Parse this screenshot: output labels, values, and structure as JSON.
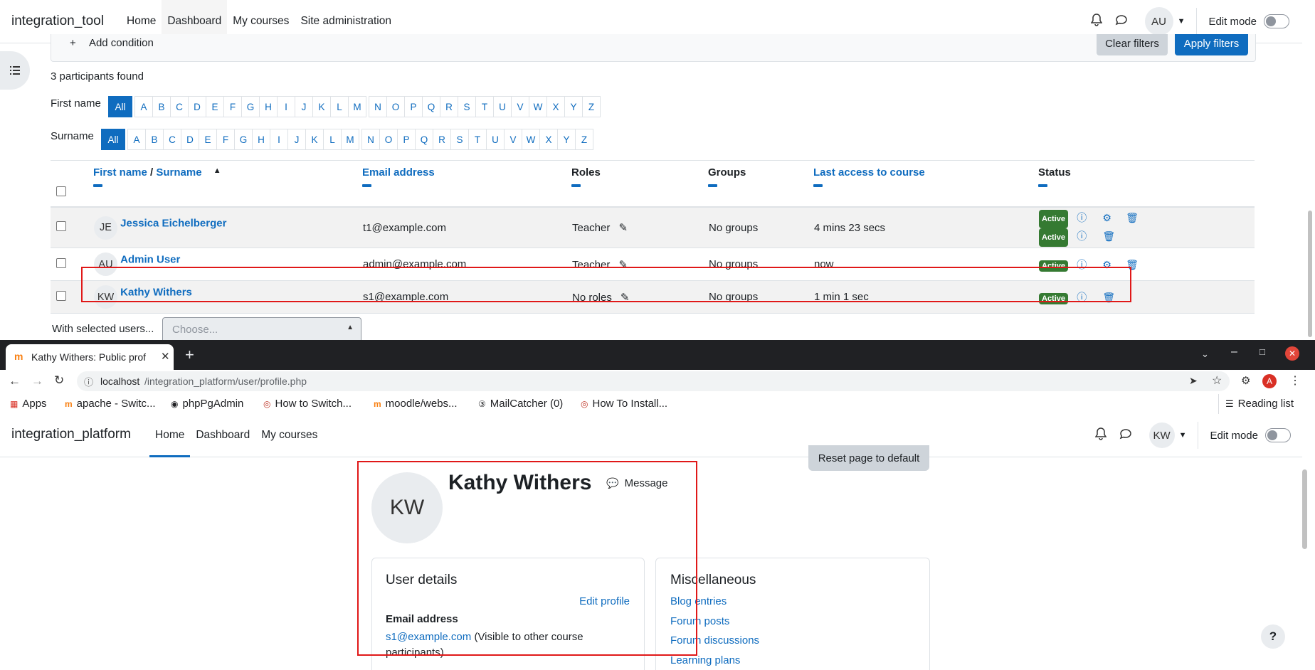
{
  "top_site": {
    "brand": "integration_tool",
    "nav": [
      "Home",
      "Dashboard",
      "My courses",
      "Site administration"
    ],
    "avatar": "AU",
    "edit_mode": "Edit mode"
  },
  "filters": {
    "add_condition": "Add condition",
    "clear": "Clear filters",
    "apply": "Apply filters"
  },
  "participants_found": "3 participants found",
  "initials": {
    "firstname_label": "First name",
    "surname_label": "Surname",
    "all": "All",
    "letters": [
      "A",
      "B",
      "C",
      "D",
      "E",
      "F",
      "G",
      "H",
      "I",
      "J",
      "K",
      "L",
      "M",
      "N",
      "O",
      "P",
      "Q",
      "R",
      "S",
      "T",
      "U",
      "V",
      "W",
      "X",
      "Y",
      "Z"
    ]
  },
  "table": {
    "headers": {
      "first_name": "First name",
      "sep": "/",
      "surname": "Surname",
      "email": "Email address",
      "roles": "Roles",
      "groups": "Groups",
      "last_access": "Last access to course",
      "status": "Status"
    },
    "rows": [
      {
        "initials": "JE",
        "name": "Jessica Eichelberger",
        "email": "t1@example.com",
        "role": "Teacher",
        "groups": "No groups",
        "last_access": "4 mins 23 secs",
        "status": [
          "Active",
          "Active"
        ]
      },
      {
        "initials": "AU",
        "name": "Admin User",
        "email": "admin@example.com",
        "role": "Teacher",
        "groups": "No groups",
        "last_access": "now",
        "status": [
          "Active"
        ]
      },
      {
        "initials": "KW",
        "name": "Kathy Withers",
        "email": "s1@example.com",
        "role": "No roles",
        "groups": "No groups",
        "last_access": "1 min 1 sec",
        "status": [
          "Active"
        ]
      }
    ]
  },
  "with_selected": {
    "label": "With selected users...",
    "placeholder": "Choose..."
  },
  "browser": {
    "tab_title": "Kathy Withers: Public prof",
    "url_host": "localhost",
    "url_path": "/integration_platform/user/profile.php",
    "profile_initial": "A",
    "bookmarks": [
      "Apps",
      "apache - Switc...",
      "phpPgAdmin",
      "How to Switch...",
      "moodle/webs...",
      "MailCatcher (0)",
      "How To Install..."
    ],
    "reading_list": "Reading list"
  },
  "bottom_site": {
    "brand": "integration_platform",
    "nav": [
      "Home",
      "Dashboard",
      "My courses"
    ],
    "avatar": "KW",
    "edit_mode": "Edit mode",
    "reset": "Reset page to default"
  },
  "profile": {
    "initials": "KW",
    "name": "Kathy Withers",
    "message": "Message",
    "user_details_title": "User details",
    "edit_profile": "Edit profile",
    "email_label": "Email address",
    "email": "s1@example.com",
    "email_note": "(Visible to other course participants)",
    "misc_title": "Miscellaneous",
    "misc_links": [
      "Blog entries",
      "Forum posts",
      "Forum discussions",
      "Learning plans"
    ]
  },
  "help": "?"
}
